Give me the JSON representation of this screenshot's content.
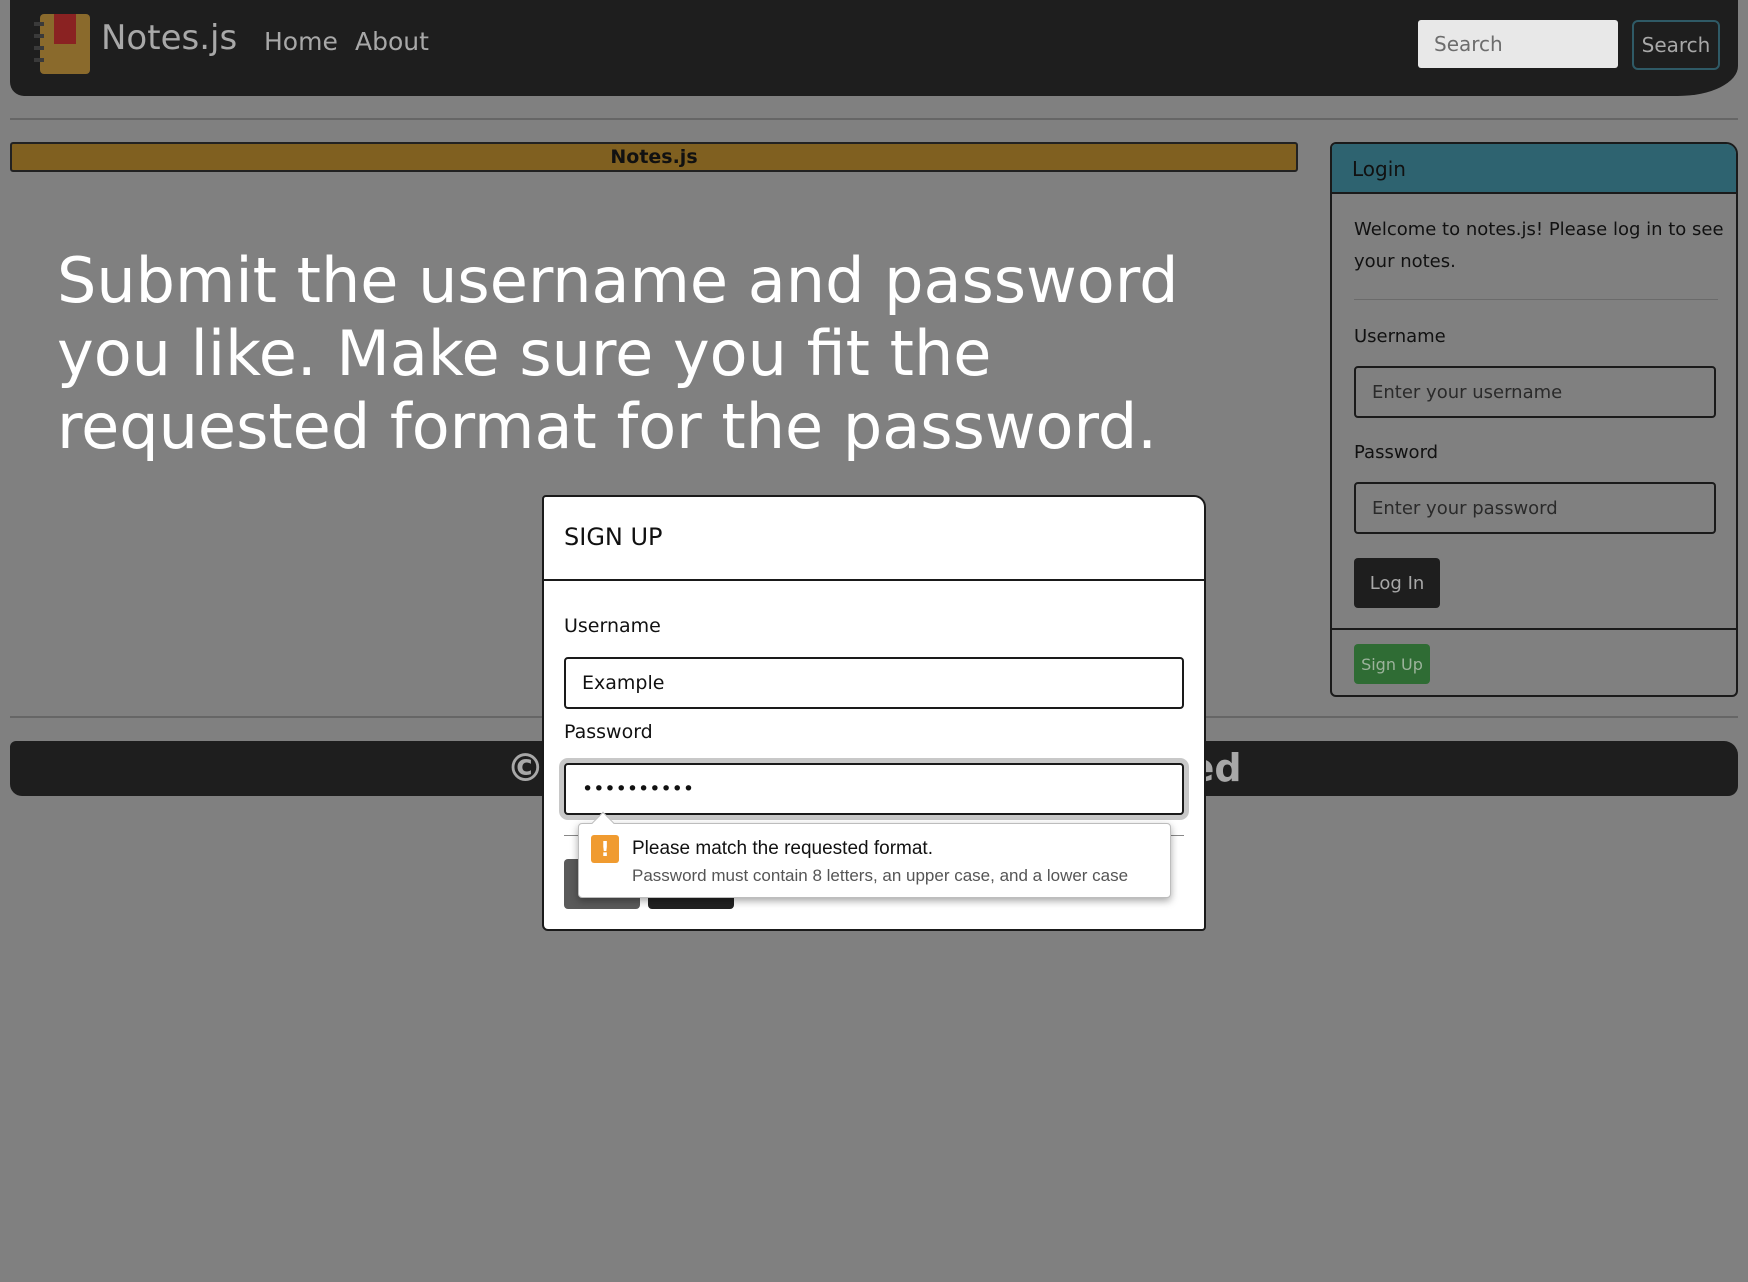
{
  "navbar": {
    "brand_name": "Notes.js",
    "brand_icon": "notebook-icon",
    "links": [
      "Home",
      "About"
    ],
    "search_placeholder": "Search",
    "search_button": "Search"
  },
  "banner": {
    "text": "Notes.js"
  },
  "instruction": "Submit the username and password you like. Make sure you fit the requested format for the password.",
  "login": {
    "title": "Login",
    "welcome": "Welcome to notes.js! Please log in to see your notes.",
    "username_label": "Username",
    "username_placeholder": "Enter your username",
    "password_label": "Password",
    "password_placeholder": "Enter your password",
    "login_button": "Log In",
    "signup_button": "Sign Up"
  },
  "footer": {
    "text": "©2025. Noah J. All rights reserved"
  },
  "signup_modal": {
    "title": "SIGN UP",
    "username_label": "Username",
    "username_value": "Example",
    "password_label": "Password",
    "password_value": "••••••••••"
  },
  "validation_tooltip": {
    "icon": "warning-icon",
    "title": "Please match the requested format.",
    "detail": "Password must contain 8 letters, an upper case, and a lower case"
  },
  "colors": {
    "overlay": "#808080",
    "banner": "#806020",
    "login_header": "#2e6370",
    "signup_button": "#2f6c34",
    "warning": "#f09b30"
  }
}
